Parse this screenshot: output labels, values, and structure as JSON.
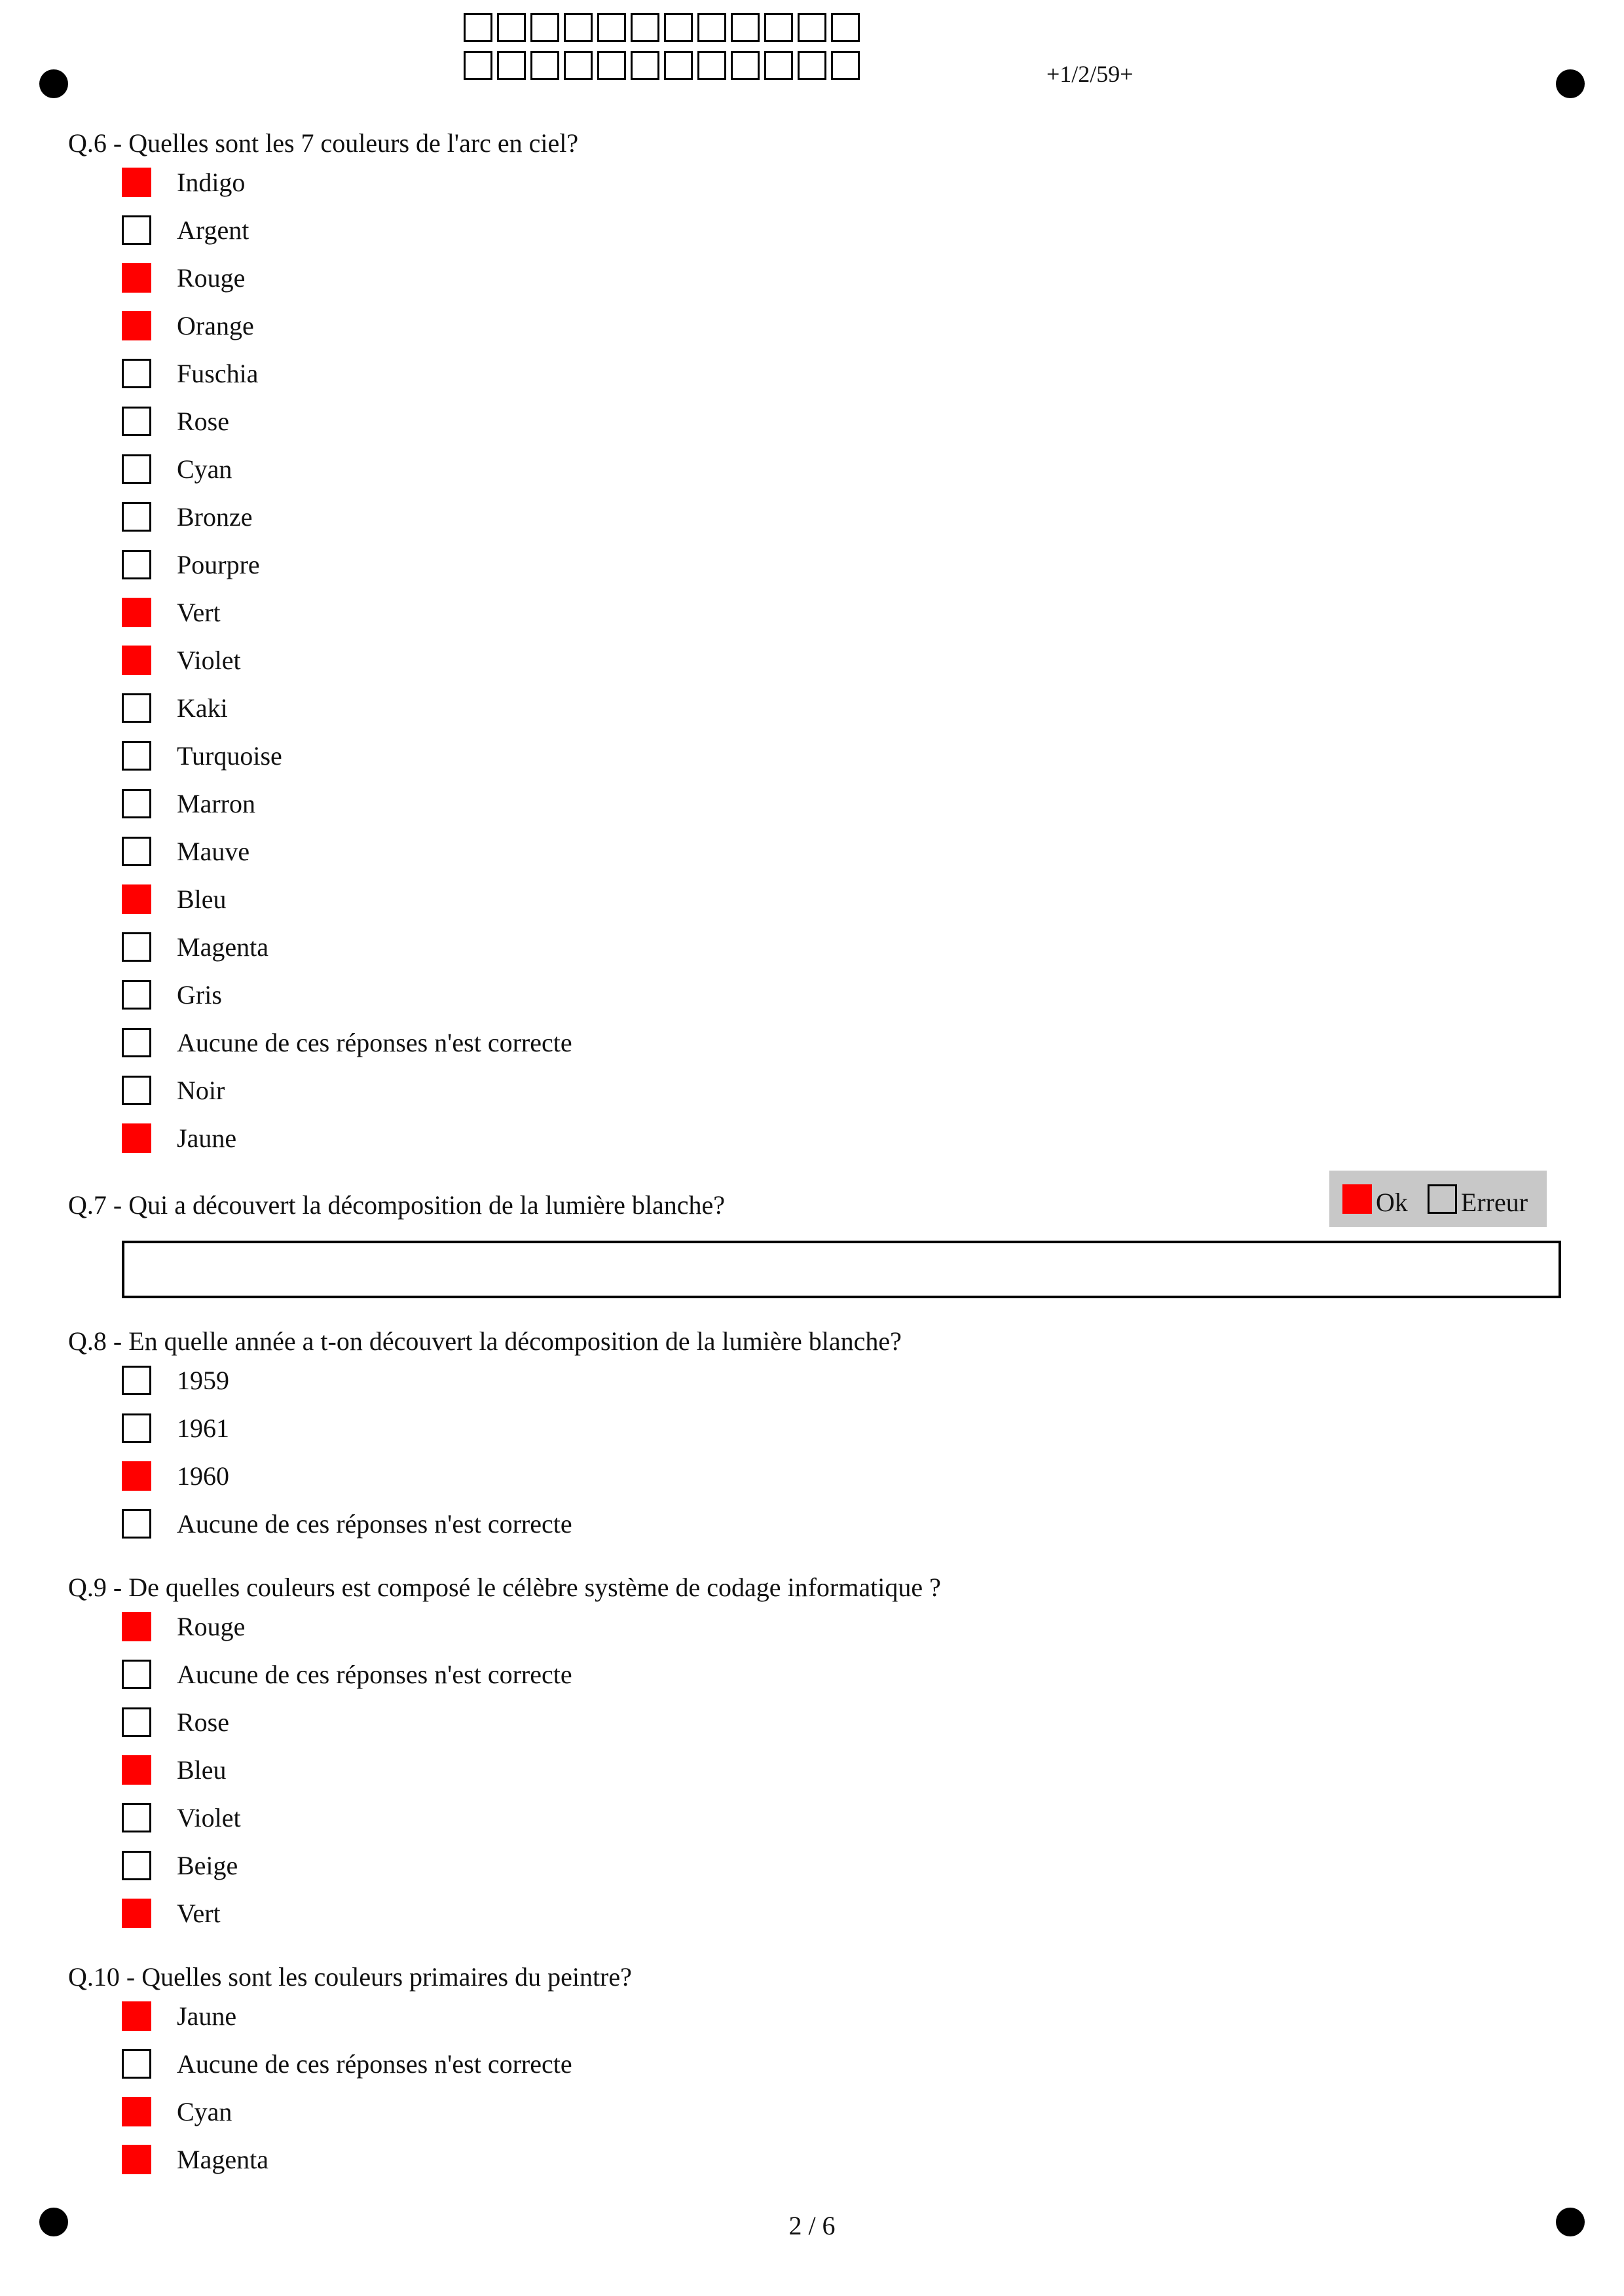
{
  "header": {
    "page_code": "+1/2/59+",
    "id_boxes_per_row": 12,
    "id_rows": 2
  },
  "colors": {
    "checked": "#ff0000",
    "grading_background": "#c8c8c8"
  },
  "questions": [
    {
      "title": "Q.6 - Quelles sont les 7 couleurs de l'arc en ciel?",
      "answers": [
        {
          "label": "Indigo",
          "checked": true
        },
        {
          "label": "Argent",
          "checked": false
        },
        {
          "label": "Rouge",
          "checked": true
        },
        {
          "label": "Orange",
          "checked": true
        },
        {
          "label": "Fuschia",
          "checked": false
        },
        {
          "label": "Rose",
          "checked": false
        },
        {
          "label": "Cyan",
          "checked": false
        },
        {
          "label": "Bronze",
          "checked": false
        },
        {
          "label": "Pourpre",
          "checked": false
        },
        {
          "label": "Vert",
          "checked": true
        },
        {
          "label": "Violet",
          "checked": true
        },
        {
          "label": "Kaki",
          "checked": false
        },
        {
          "label": "Turquoise",
          "checked": false
        },
        {
          "label": "Marron",
          "checked": false
        },
        {
          "label": "Mauve",
          "checked": false
        },
        {
          "label": "Bleu",
          "checked": true
        },
        {
          "label": "Magenta",
          "checked": false
        },
        {
          "label": "Gris",
          "checked": false
        },
        {
          "label": "Aucune de ces réponses n'est correcte",
          "checked": false
        },
        {
          "label": "Noir",
          "checked": false
        },
        {
          "label": "Jaune",
          "checked": true
        }
      ]
    },
    {
      "title": "Q.7 - Qui a découvert la décomposition de la lumière blanche?",
      "answers": []
    },
    {
      "title": "Q.8 - En quelle année a t-on découvert la décomposition de la lumière blanche?",
      "answers": [
        {
          "label": "1959",
          "checked": false
        },
        {
          "label": "1961",
          "checked": false
        },
        {
          "label": "1960",
          "checked": true
        },
        {
          "label": "Aucune de ces réponses n'est correcte",
          "checked": false
        }
      ]
    },
    {
      "title": "Q.9 - De quelles couleurs est composé le célèbre système de codage informatique ?",
      "answers": [
        {
          "label": "Rouge",
          "checked": true
        },
        {
          "label": "Aucune de ces réponses n'est correcte",
          "checked": false
        },
        {
          "label": "Rose",
          "checked": false
        },
        {
          "label": "Bleu",
          "checked": true
        },
        {
          "label": "Violet",
          "checked": false
        },
        {
          "label": "Beige",
          "checked": false
        },
        {
          "label": "Vert",
          "checked": true
        }
      ]
    },
    {
      "title": "Q.10 - Quelles sont les couleurs primaires du peintre?",
      "answers": [
        {
          "label": "Jaune",
          "checked": true
        },
        {
          "label": "Aucune de ces réponses n'est correcte",
          "checked": false
        },
        {
          "label": "Cyan",
          "checked": true
        },
        {
          "label": "Magenta",
          "checked": true
        }
      ]
    }
  ],
  "q7_grading": {
    "ok_label": "Ok",
    "ok_checked": true,
    "error_label": "Erreur",
    "error_checked": false
  },
  "footer": {
    "page_number": "2 / 6"
  }
}
